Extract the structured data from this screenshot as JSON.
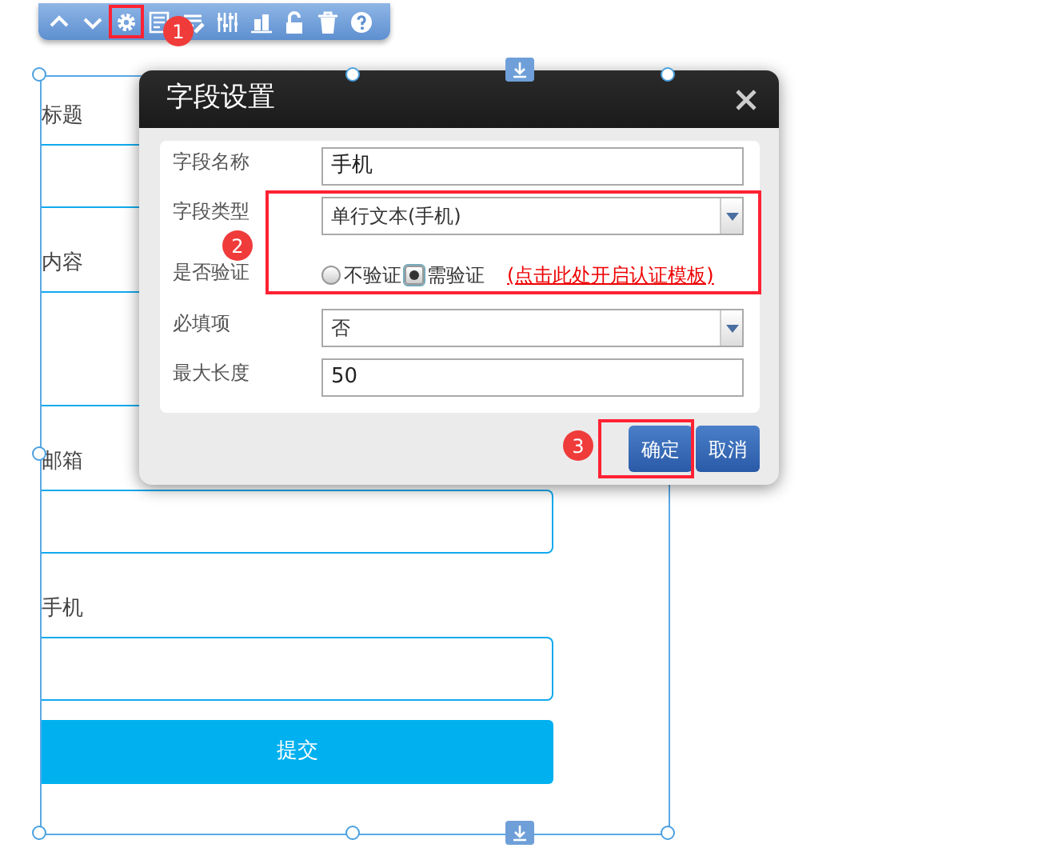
{
  "toolbar": {
    "buttons": [
      {
        "kind": "up"
      },
      {
        "kind": "down"
      },
      {
        "kind": "gear"
      },
      {
        "kind": "form"
      },
      {
        "kind": "list"
      },
      {
        "kind": "sliders"
      },
      {
        "kind": "chart"
      },
      {
        "kind": "unlock"
      },
      {
        "kind": "trash"
      },
      {
        "kind": "help"
      }
    ]
  },
  "form": {
    "fields": [
      {
        "label": "标题",
        "kind": "input"
      },
      {
        "label": "内容",
        "kind": "textarea"
      },
      {
        "label": "邮箱",
        "kind": "input"
      },
      {
        "label": "手机",
        "kind": "input"
      }
    ],
    "submit": "提交"
  },
  "dialog": {
    "title": "字段设置",
    "rows": [
      {
        "kind": "text",
        "label": "字段名称",
        "value": "手机"
      },
      {
        "kind": "select",
        "label": "字段类型",
        "value": "单行文本(手机)"
      },
      {
        "kind": "radio",
        "label": "是否验证",
        "options": [
          {
            "label": "不验证",
            "selected": false
          },
          {
            "label": "需验证",
            "selected": true
          }
        ],
        "link": "(点击此处开启认证模板)"
      },
      {
        "kind": "select",
        "label": "必填项",
        "value": "否"
      },
      {
        "kind": "text",
        "label": "最大长度",
        "value": "50"
      }
    ],
    "buttons": [
      {
        "label": "确定"
      },
      {
        "label": "取消"
      }
    ]
  },
  "annotations": [
    {
      "number": "1"
    },
    {
      "number": "2"
    },
    {
      "number": "3"
    }
  ]
}
